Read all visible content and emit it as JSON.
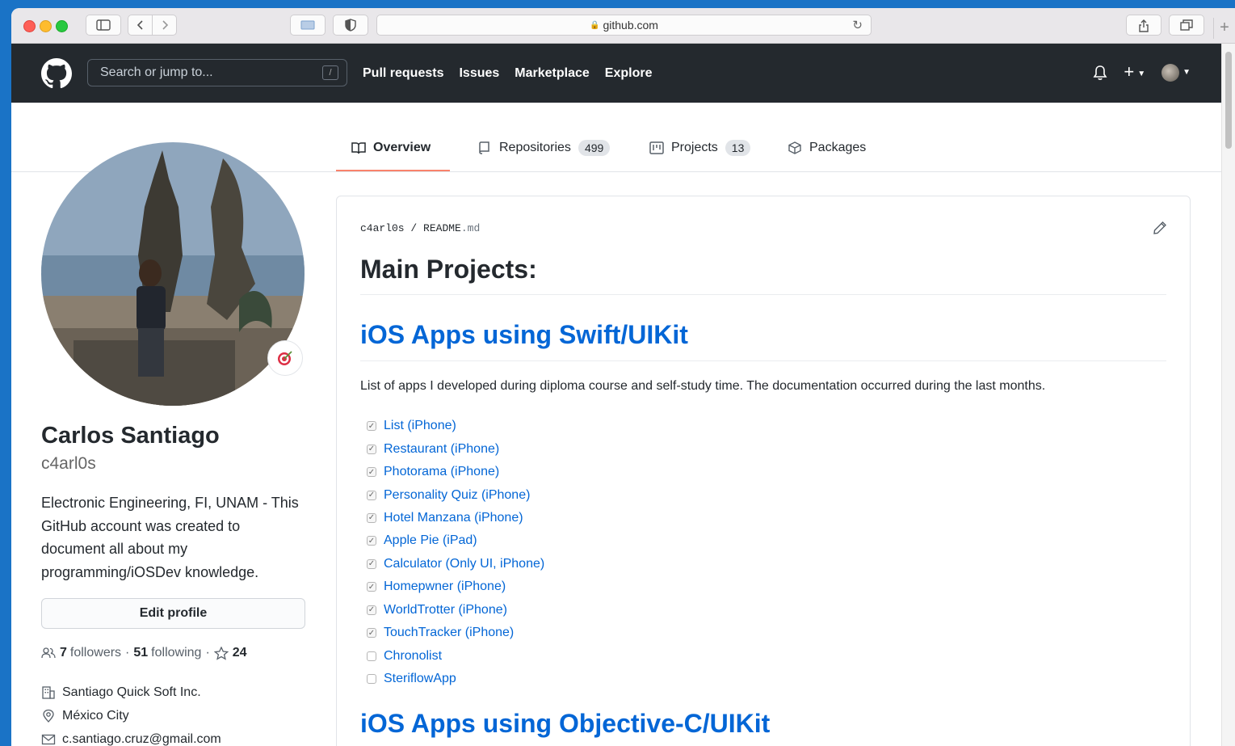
{
  "browser": {
    "url": "github.com"
  },
  "header": {
    "search_placeholder": "Search or jump to...",
    "search_shortcut": "/",
    "nav": [
      "Pull requests",
      "Issues",
      "Marketplace",
      "Explore"
    ],
    "plus_label": "+"
  },
  "tabs": [
    {
      "label": "Overview",
      "icon": "book-icon",
      "active": true
    },
    {
      "label": "Repositories",
      "icon": "repo-icon",
      "count": "499"
    },
    {
      "label": "Projects",
      "icon": "project-icon",
      "count": "13"
    },
    {
      "label": "Packages",
      "icon": "package-icon"
    }
  ],
  "profile": {
    "name": "Carlos Santiago",
    "login": "c4arl0s",
    "bio": "Electronic Engineering, FI, UNAM - This GitHub account was created to document all about my programming/iOSDev knowledge.",
    "edit_label": "Edit profile",
    "followers_count": "7",
    "followers_label": "followers",
    "following_count": "51",
    "following_label": "following",
    "stars_count": "24",
    "company": "Santiago Quick Soft Inc.",
    "location": "México City",
    "email": "c.santiago.cruz@gmail.com"
  },
  "readme": {
    "owner": "c4arl0s",
    "separator": "/",
    "file": "README",
    "ext": ".md",
    "heading": "Main Projects:",
    "section1": "iOS Apps using Swift/UIKit",
    "description": "List of apps I developed during diploma course and self-study time. The documentation occurred during the last months.",
    "tasks": [
      {
        "label": "List (iPhone)",
        "done": true
      },
      {
        "label": "Restaurant (iPhone)",
        "done": true
      },
      {
        "label": "Photorama (iPhone)",
        "done": true
      },
      {
        "label": "Personality Quiz (iPhone)",
        "done": true
      },
      {
        "label": "Hotel Manzana (iPhone)",
        "done": true
      },
      {
        "label": "Apple Pie (iPad)",
        "done": true
      },
      {
        "label": "Calculator (Only UI, iPhone)",
        "done": true
      },
      {
        "label": "Homepwner (iPhone)",
        "done": true
      },
      {
        "label": "WorldTrotter (iPhone)",
        "done": true
      },
      {
        "label": "TouchTracker (iPhone)",
        "done": true
      },
      {
        "label": "Chronolist",
        "done": false
      },
      {
        "label": "SteriflowApp",
        "done": false
      }
    ],
    "section2": "iOS Apps using Objective-C/UIKit"
  },
  "colors": {
    "header_bg": "#24292e",
    "link": "#0366d6",
    "tab_underline": "#f9826c"
  }
}
